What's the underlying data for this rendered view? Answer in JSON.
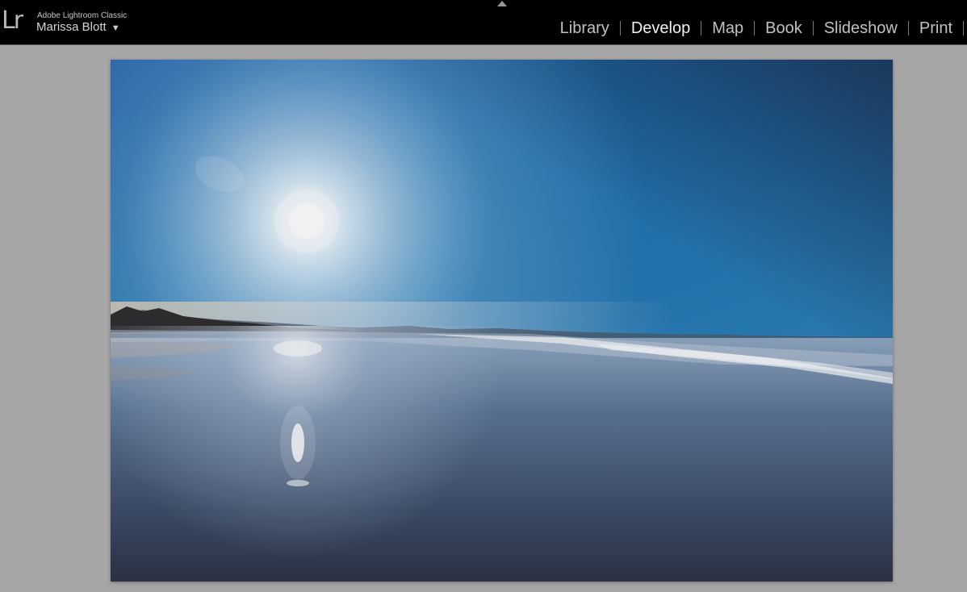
{
  "app": {
    "logo": "Lr",
    "name": "Adobe Lightroom Classic",
    "identity": "Marissa Blott",
    "identity_caret": "▼",
    "panel_toggle_icon": "triangle-up-icon"
  },
  "modules": [
    {
      "label": "Library",
      "active": false
    },
    {
      "label": "Develop",
      "active": true
    },
    {
      "label": "Map",
      "active": false
    },
    {
      "label": "Book",
      "active": false
    },
    {
      "label": "Slideshow",
      "active": false
    },
    {
      "label": "Print",
      "active": false
    }
  ],
  "photo": {
    "subject": "beach-sunset-photo"
  },
  "colors": {
    "topbar": "#000000",
    "workspace": "#a6a6a6",
    "active_module": "#f2f2f2",
    "inactive_module": "#c2c2c2"
  }
}
